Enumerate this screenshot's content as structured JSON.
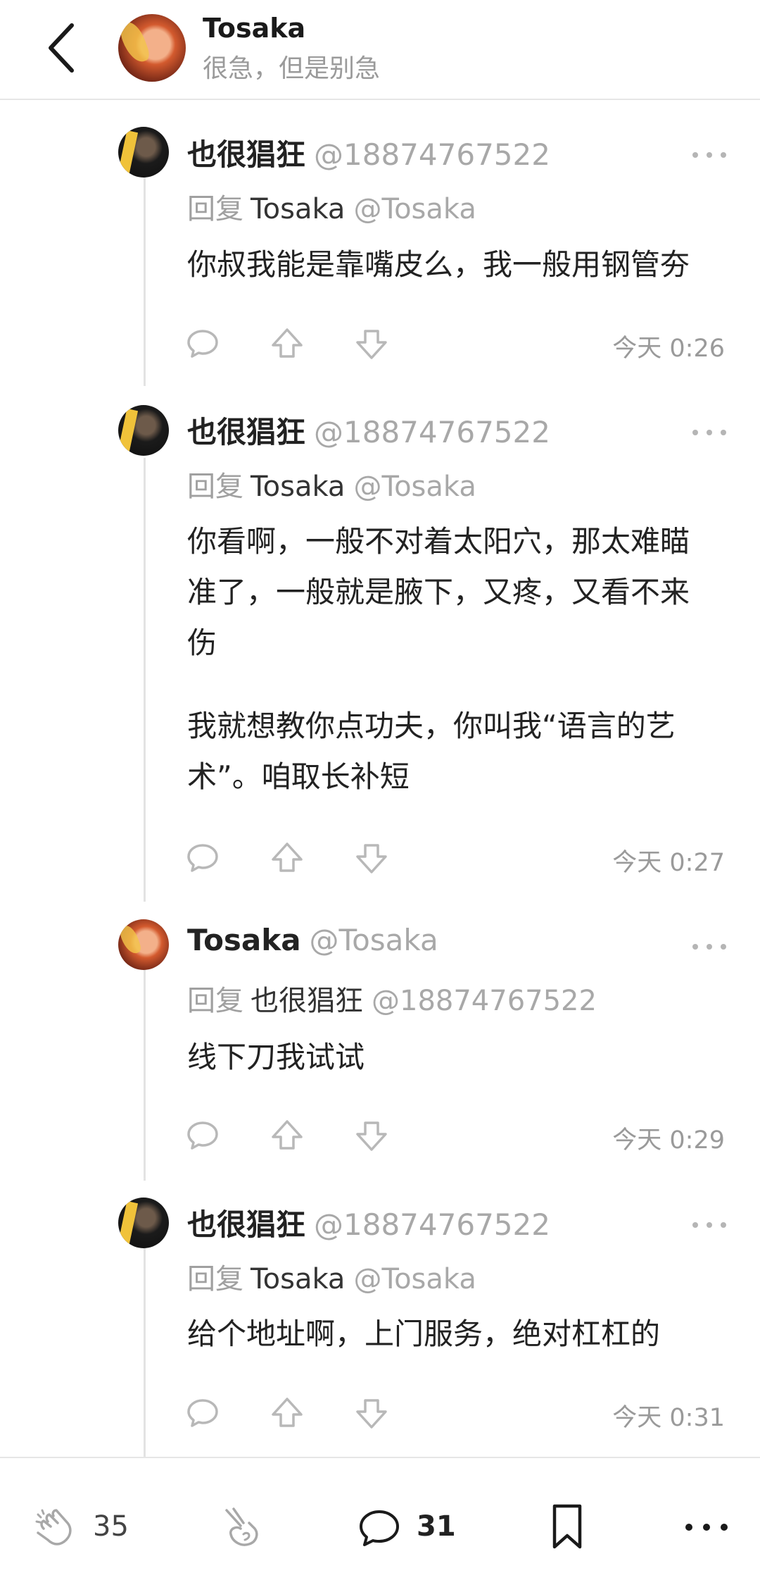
{
  "header": {
    "title": "Tosaka",
    "subtitle": "很急，但是别急"
  },
  "comments": [
    {
      "name": "也很猖狂",
      "handle": "@18874767522",
      "reply_prefix": "回复",
      "reply_to_name": "Tosaka",
      "reply_to_handle": "@Tosaka",
      "text": [
        "你叔我能是靠嘴皮么，我一般用钢管夯"
      ],
      "time": "今天 0:26"
    },
    {
      "name": "也很猖狂",
      "handle": "@18874767522",
      "reply_prefix": "回复",
      "reply_to_name": "Tosaka",
      "reply_to_handle": "@Tosaka",
      "text": [
        "你看啊，一般不对着太阳穴，那太难瞄",
        "准了，一般就是腋下，又疼，又看不来",
        "伤",
        "我就想教你点功夫，你叫我“语言的艺",
        "术”。咱取长补短"
      ],
      "time": "今天 0:27"
    },
    {
      "name": "Tosaka",
      "handle": "@Tosaka",
      "reply_prefix": "回复",
      "reply_to_name": "也很猖狂",
      "reply_to_handle": "@18874767522",
      "text": [
        "线下刀我试试"
      ],
      "time": "今天 0:29"
    },
    {
      "name": "也很猖狂",
      "handle": "@18874767522",
      "reply_prefix": "回复",
      "reply_to_name": "Tosaka",
      "reply_to_handle": "@Tosaka",
      "text": [
        "给个地址啊，上门服务，绝对杠杠的"
      ],
      "time": "今天 0:31"
    }
  ],
  "bottom_bar": {
    "clap_count": "35",
    "comment_count": "31"
  },
  "icons": {
    "back": "chevron-left-icon",
    "more": "more-dots-icon",
    "reply": "comment-bubble-icon",
    "upvote": "arrow-up-icon",
    "downvote": "arrow-down-icon",
    "clap": "clap-hands-icon",
    "hand": "hand-icon",
    "comment": "speech-bubble-icon",
    "bookmark": "bookmark-icon"
  }
}
